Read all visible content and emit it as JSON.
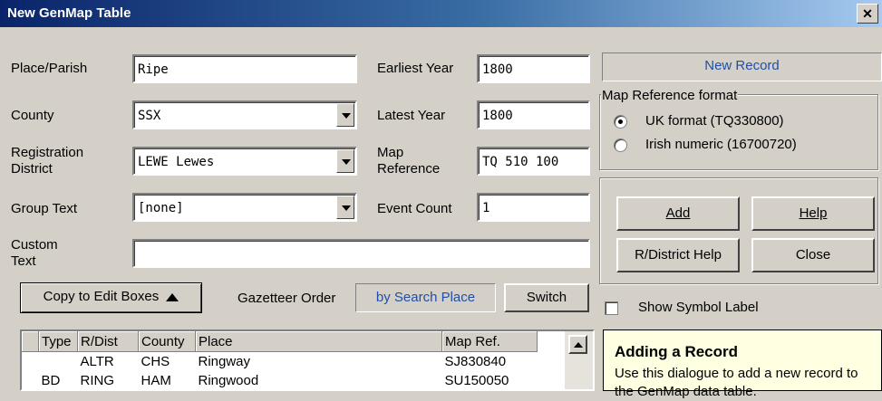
{
  "window": {
    "title": "New GenMap Table",
    "close_label": "✕"
  },
  "form": {
    "place_label": "Place/Parish",
    "place_value": "Ripe",
    "county_label": "County",
    "county_value": "SSX",
    "regdist_label_1": "Registration",
    "regdist_label_2": "District",
    "regdist_value": "LEWE Lewes",
    "group_label": "Group Text",
    "group_value": "[none]",
    "custom_label_1": "Custom",
    "custom_label_2": "Text",
    "custom_value": "",
    "earliest_label": "Earliest Year",
    "earliest_value": "1800",
    "latest_label": "Latest Year",
    "latest_value": "1800",
    "mapref_label_1": "Map",
    "mapref_label_2": "Reference",
    "mapref_value": "TQ 510 100",
    "eventcount_label": "Event Count",
    "eventcount_value": "1"
  },
  "right": {
    "new_record": "New Record",
    "mapformat_title": "Map Reference format",
    "uk_format": "UK format (TQ330800)",
    "irish_format": "Irish numeric (16700720)",
    "uk_selected": true,
    "add": "Add",
    "help": "Help",
    "rdist_help": "R/District Help",
    "close": "Close",
    "show_symbol_label": "Show Symbol Label"
  },
  "gazetteer": {
    "copy_button": "Copy to Edit Boxes",
    "order_label": "Gazetteer Order",
    "order_value": "by Search Place",
    "switch_button": "Switch"
  },
  "table": {
    "headers": [
      "",
      "Type",
      "R/Dist",
      "County",
      "Place",
      "Map Ref."
    ],
    "rows": [
      [
        "",
        "",
        "ALTR",
        "CHS",
        "Ringway",
        "SJ830840"
      ],
      [
        "",
        "BD",
        "RING",
        "HAM",
        "Ringwood",
        "SU150050"
      ]
    ]
  },
  "help_panel": {
    "title": "Adding a Record",
    "text": "Use this dialogue to add a new record to the GenMap data table."
  },
  "colors": {
    "title_start": "#0a246a",
    "title_end": "#a6caf0",
    "accent_link": "#1f4fa8",
    "help_bg": "#ffffe1"
  }
}
